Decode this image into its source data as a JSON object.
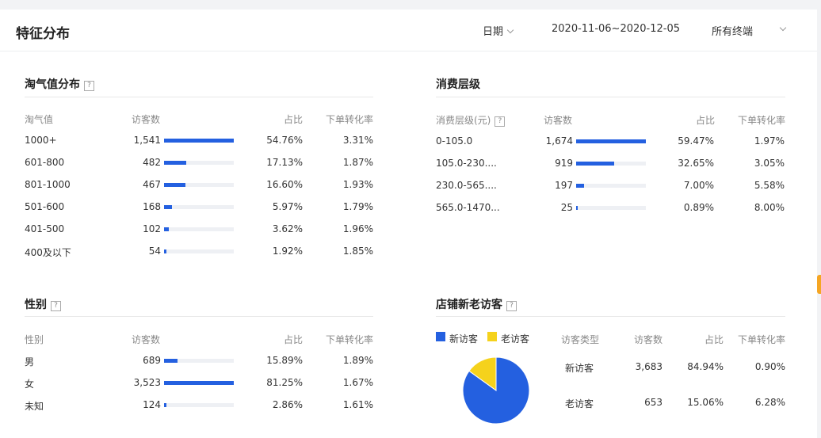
{
  "page_title": "特征分布",
  "header": {
    "date_label": "日期",
    "date_range": "2020-11-06~2020-12-05",
    "terminal": "所有终端"
  },
  "help_mark": "?",
  "taoqi": {
    "title": "淘气值分布",
    "headers": [
      "淘气值",
      "访客数",
      "占比",
      "下单转化率"
    ],
    "rows": [
      {
        "label": "1000+",
        "visitors": "1,541",
        "share": "54.76%",
        "conv": "3.31%",
        "fill": 1.0
      },
      {
        "label": "601-800",
        "visitors": "482",
        "share": "17.13%",
        "conv": "1.87%",
        "fill": 0.313
      },
      {
        "label": "801-1000",
        "visitors": "467",
        "share": "16.60%",
        "conv": "1.93%",
        "fill": 0.303
      },
      {
        "label": "501-600",
        "visitors": "168",
        "share": "5.97%",
        "conv": "1.79%",
        "fill": 0.109
      },
      {
        "label": "401-500",
        "visitors": "102",
        "share": "3.62%",
        "conv": "1.96%",
        "fill": 0.066
      },
      {
        "label": "400及以下",
        "visitors": "54",
        "share": "1.92%",
        "conv": "1.85%",
        "fill": 0.035
      }
    ]
  },
  "spend": {
    "title": "消费层级",
    "headers": [
      "消费层级(元)",
      "访客数",
      "占比",
      "下单转化率"
    ],
    "rows": [
      {
        "label": "0-105.0",
        "visitors": "1,674",
        "share": "59.47%",
        "conv": "1.97%",
        "fill": 1.0
      },
      {
        "label": "105.0-230....",
        "visitors": "919",
        "share": "32.65%",
        "conv": "3.05%",
        "fill": 0.549
      },
      {
        "label": "230.0-565....",
        "visitors": "197",
        "share": "7.00%",
        "conv": "5.58%",
        "fill": 0.118
      },
      {
        "label": "565.0-1470...",
        "visitors": "25",
        "share": "0.89%",
        "conv": "8.00%",
        "fill": 0.015
      }
    ]
  },
  "gender": {
    "title": "性别",
    "headers": [
      "性别",
      "访客数",
      "占比",
      "下单转化率"
    ],
    "rows": [
      {
        "label": "男",
        "visitors": "689",
        "share": "15.89%",
        "conv": "1.89%",
        "fill": 0.196
      },
      {
        "label": "女",
        "visitors": "3,523",
        "share": "81.25%",
        "conv": "1.67%",
        "fill": 1.0
      },
      {
        "label": "未知",
        "visitors": "124",
        "share": "2.86%",
        "conv": "1.61%",
        "fill": 0.035
      }
    ]
  },
  "newold": {
    "title": "店铺新老访客",
    "legend": [
      {
        "name": "新访客",
        "color": "#2460e0"
      },
      {
        "name": "老访客",
        "color": "#f5d21c"
      }
    ],
    "headers": [
      "访客类型",
      "访客数",
      "占比",
      "下单转化率"
    ],
    "rows": [
      {
        "label": "新访客",
        "visitors": "3,683",
        "share": "84.94%",
        "conv": "0.90%"
      },
      {
        "label": "老访客",
        "visitors": "653",
        "share": "15.06%",
        "conv": "6.28%"
      }
    ],
    "pie": [
      {
        "name": "新访客",
        "value": 84.94,
        "color": "#2460e0"
      },
      {
        "name": "老访客",
        "value": 15.06,
        "color": "#f5d21c"
      }
    ]
  }
}
